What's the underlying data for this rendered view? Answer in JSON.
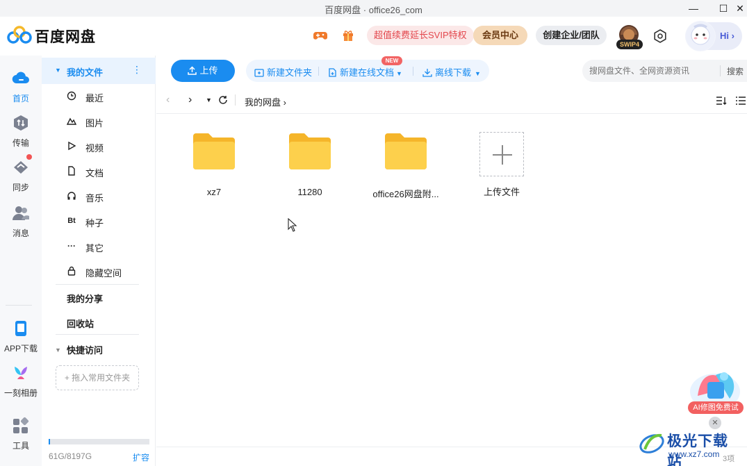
{
  "window": {
    "title": "百度网盘 · office26_com"
  },
  "header": {
    "brand": "百度网盘",
    "promo": "超值续费延长SVIP特权",
    "vip_center": "会员中心",
    "create_team": "创建企业/团队",
    "svip_level": "SWIP4",
    "greeting": "Hi ›",
    "icons": [
      "game-icon",
      "gift-icon",
      "settings-icon"
    ]
  },
  "rail": {
    "items": [
      {
        "label": "首页",
        "icon": "cloud-home-icon"
      },
      {
        "label": "传输",
        "icon": "transfer-icon"
      },
      {
        "label": "同步",
        "icon": "sync-icon"
      },
      {
        "label": "消息",
        "icon": "message-icon"
      },
      {
        "label": "APP下载",
        "icon": "phone-icon"
      },
      {
        "label": "一刻相册",
        "icon": "album-icon"
      },
      {
        "label": "工具",
        "icon": "tools-icon"
      }
    ]
  },
  "nav": {
    "my_files": "我的文件",
    "items": [
      {
        "label": "最近",
        "icon": "clock-icon"
      },
      {
        "label": "图片",
        "icon": "image-icon"
      },
      {
        "label": "视频",
        "icon": "play-icon"
      },
      {
        "label": "文档",
        "icon": "document-icon"
      },
      {
        "label": "音乐",
        "icon": "headphones-icon"
      },
      {
        "label": "种子",
        "icon": "bt-icon",
        "glyph": "Bt"
      },
      {
        "label": "其它",
        "icon": "more-icon"
      },
      {
        "label": "隐藏空间",
        "icon": "lock-icon"
      }
    ],
    "my_share": "我的分享",
    "recycle": "回收站",
    "quick_access": "快捷访问",
    "drop_hint": "+ 拖入常用文件夹",
    "quota": "61G/8197G",
    "quota_fraction": 0.0074,
    "expand": "扩容"
  },
  "toolbar": {
    "upload": "上传",
    "new_folder": "新建文件夹",
    "new_online_doc": "新建在线文档",
    "new_badge": "NEW",
    "offline_download": "离线下载",
    "search_placeholder": "搜网盘文件、全网资源资讯",
    "search_button": "搜索"
  },
  "breadcrumb": {
    "path": "我的网盘  ›"
  },
  "files": [
    {
      "name": "xz7",
      "type": "folder"
    },
    {
      "name": "11280",
      "type": "folder"
    },
    {
      "name": "office26网盘附...",
      "type": "folder"
    }
  ],
  "upload_tile": {
    "label": "上传文件"
  },
  "ai_float": {
    "label": "AI修图免费试"
  },
  "footer": {
    "count": "3项"
  },
  "watermark": {
    "brand": "极光下载站",
    "url": "www.xz7.com"
  },
  "colors": {
    "accent": "#1a8cf0",
    "promo_red": "#e3474d",
    "folder": "#fcc63d"
  }
}
